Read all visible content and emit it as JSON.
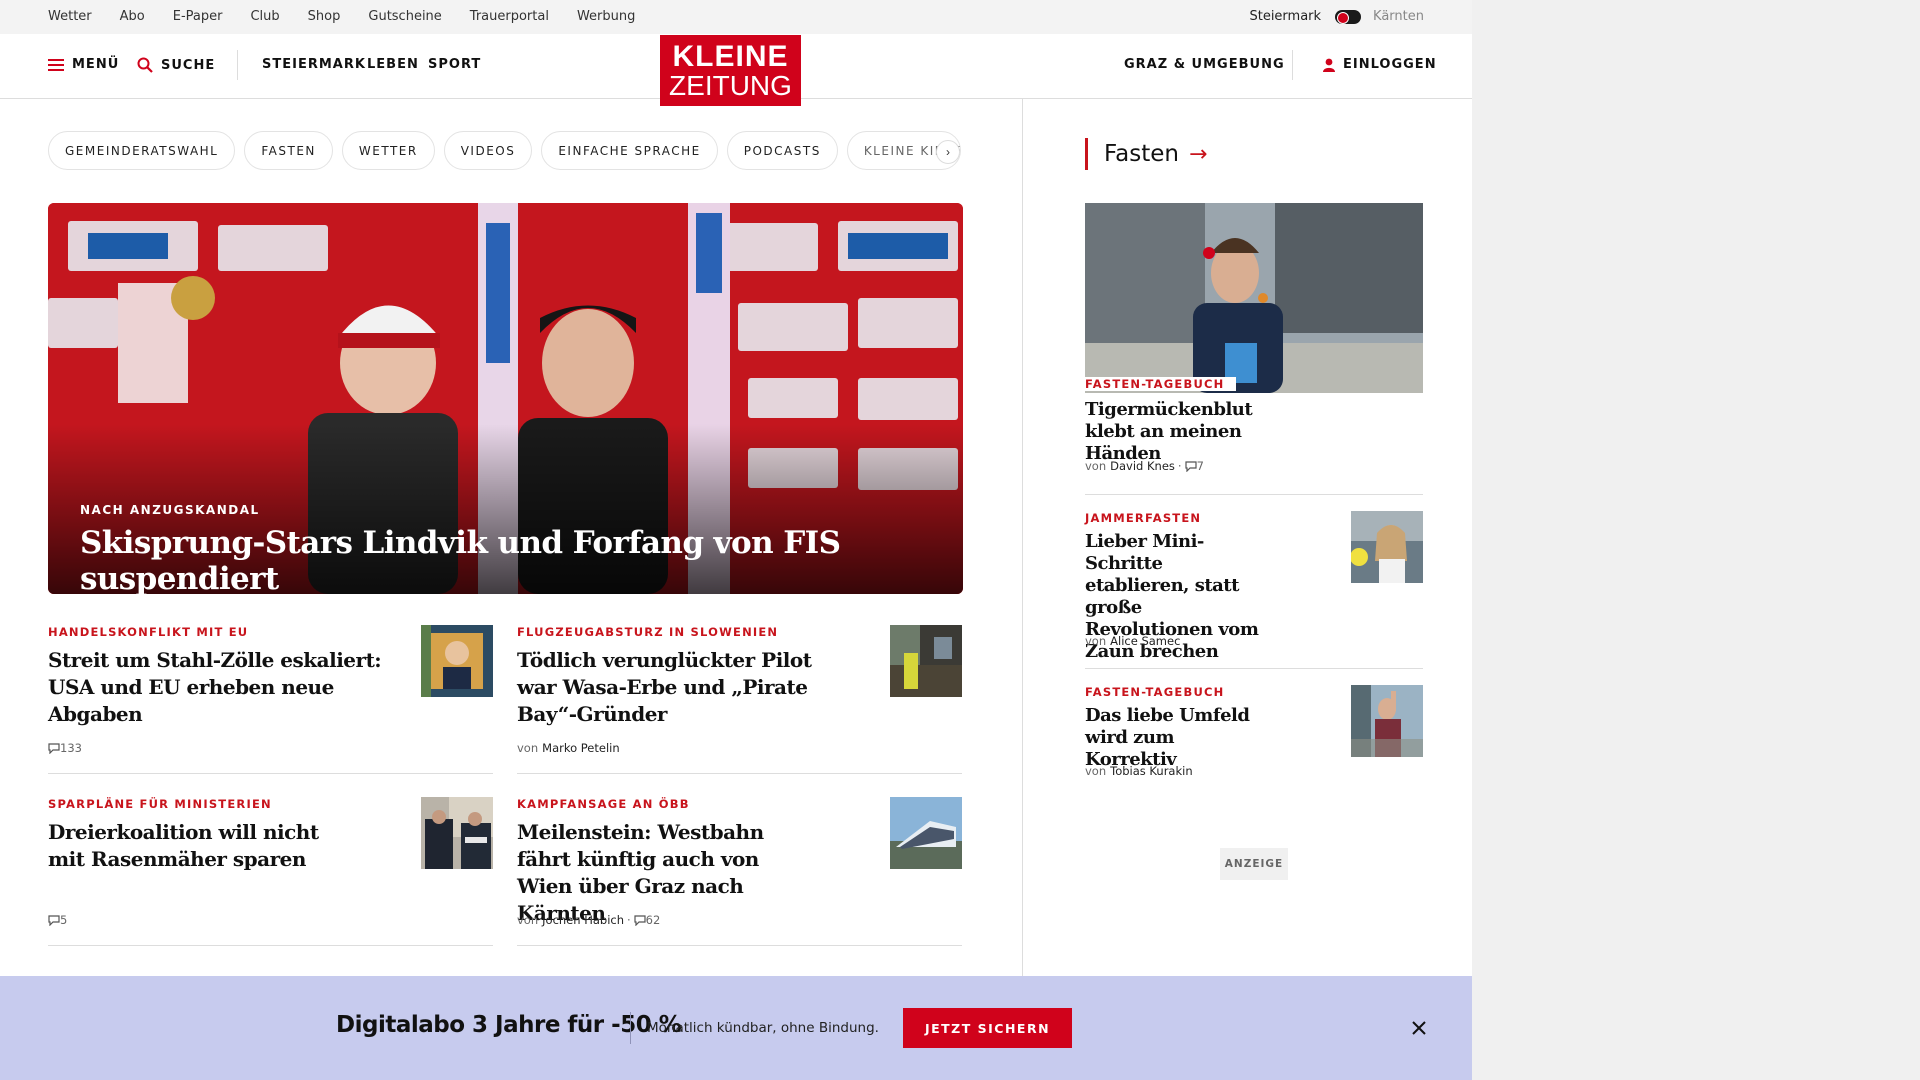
{
  "utility": {
    "links": [
      "Wetter",
      "Abo",
      "E-Paper",
      "Club",
      "Shop",
      "Gutscheine",
      "Trauerportal",
      "Werbung"
    ],
    "region_active": "Steiermark",
    "region_inactive": "Kärnten"
  },
  "header": {
    "menu_label": "MENÜ",
    "search_label": "SUCHE",
    "nav": [
      "STEIERMARK",
      "LEBEN",
      "SPORT"
    ],
    "logo_line1": "KLEINE",
    "logo_line2": "ZEITUNG",
    "local_label": "GRAZ & UMGEBUNG",
    "login_label": "EINLOGGEN",
    "brand_color": "#d0021b"
  },
  "chips": [
    "GEMEINDERATSWAHL",
    "FASTEN",
    "WETTER",
    "VIDEOS",
    "EINFACHE SPRACHE",
    "PODCASTS",
    "KLEINE KINDE"
  ],
  "hero": {
    "kicker": "NACH ANZUGSKANDAL",
    "title": "Skisprung-Stars Lindvik und Forfang von FIS suspendiert"
  },
  "articles": [
    {
      "kicker": "HANDELSKONFLIKT MIT EU",
      "title": "Streit um Stahl-Zölle eskaliert: USA und EU erheben neue Abgaben",
      "author": "",
      "comments": "133"
    },
    {
      "kicker": "FLUGZEUGABSTURZ IN SLOWENIEN",
      "title": "Tödlich verunglückter Pilot war Wasa-Erbe und „Pirate Bay“-Gründer",
      "by": "von",
      "author": "Marko Petelin",
      "comments": ""
    },
    {
      "kicker": "SPARPLÄNE FÜR MINISTERIEN",
      "title": "Dreierkoalition will nicht mit Rasenmäher sparen",
      "author": "",
      "comments": "5"
    },
    {
      "kicker": "KAMPFANSAGE AN ÖBB",
      "title": "Meilenstein: Westbahn fährt künftig auch von Wien über Graz nach Kärnten",
      "by": "von",
      "author": "Jochen Habich",
      "comments": "62"
    }
  ],
  "sidebar": {
    "heading": "Fasten",
    "items": [
      {
        "kicker": "FASTEN-TAGEBUCH",
        "title": "Tigermückenblut klebt an meinen Händen",
        "by": "von",
        "author": "David Knes",
        "comments": "7"
      },
      {
        "kicker": "JAMMERFASTEN",
        "title": "Lieber Mini-Schritte etablieren, statt große Revolutionen vom Zaun brechen",
        "by": "von",
        "author": "Alice Samec"
      },
      {
        "kicker": "FASTEN-TAGEBUCH",
        "title": "Das liebe Umfeld wird zum Korrektiv",
        "by": "von",
        "author": "Tobias Kurakin"
      }
    ],
    "ad_label": "ANZEIGE"
  },
  "promo": {
    "title": "Digitalabo 3 Jahre für -50 %",
    "subtitle": "Monatlich kündbar, ohne Bindung.",
    "button": "JETZT SICHERN"
  }
}
